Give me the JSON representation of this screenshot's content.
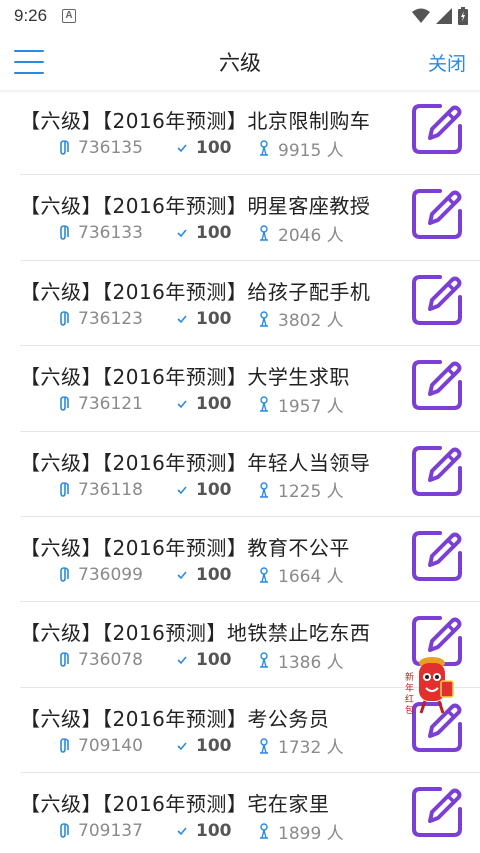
{
  "status_bar": {
    "time": "9:26",
    "a_label": "A"
  },
  "header": {
    "title": "六级",
    "close_label": "关闭"
  },
  "colors": {
    "accent": "#2a8adf",
    "edit_icon": "#7b3fd6",
    "meta_icon": "#2a8adf"
  },
  "items": [
    {
      "title": "【六级】【2016年预测】北京限制购车",
      "id": "736135",
      "score": "100",
      "users": "9915 人"
    },
    {
      "title": "【六级】【2016年预测】明星客座教授",
      "id": "736133",
      "score": "100",
      "users": "2046 人"
    },
    {
      "title": "【六级】【2016年预测】给孩子配手机",
      "id": "736123",
      "score": "100",
      "users": "3802 人"
    },
    {
      "title": "【六级】【2016年预测】大学生求职",
      "id": "736121",
      "score": "100",
      "users": "1957 人"
    },
    {
      "title": "【六级】【2016年预测】年轻人当领导",
      "id": "736118",
      "score": "100",
      "users": "1225 人"
    },
    {
      "title": "【六级】【2016年预测】教育不公平",
      "id": "736099",
      "score": "100",
      "users": "1664 人"
    },
    {
      "title": "【六级】【2016预测】地铁禁止吃东西",
      "id": "736078",
      "score": "100",
      "users": "1386 人"
    },
    {
      "title": "【六级】【2016年预测】考公务员",
      "id": "709140",
      "score": "100",
      "users": "1732 人"
    },
    {
      "title": "【六级】【2016年预测】宅在家里",
      "id": "709137",
      "score": "100",
      "users": "1899 人"
    }
  ],
  "floating_badge": {
    "label": "新年红包"
  }
}
